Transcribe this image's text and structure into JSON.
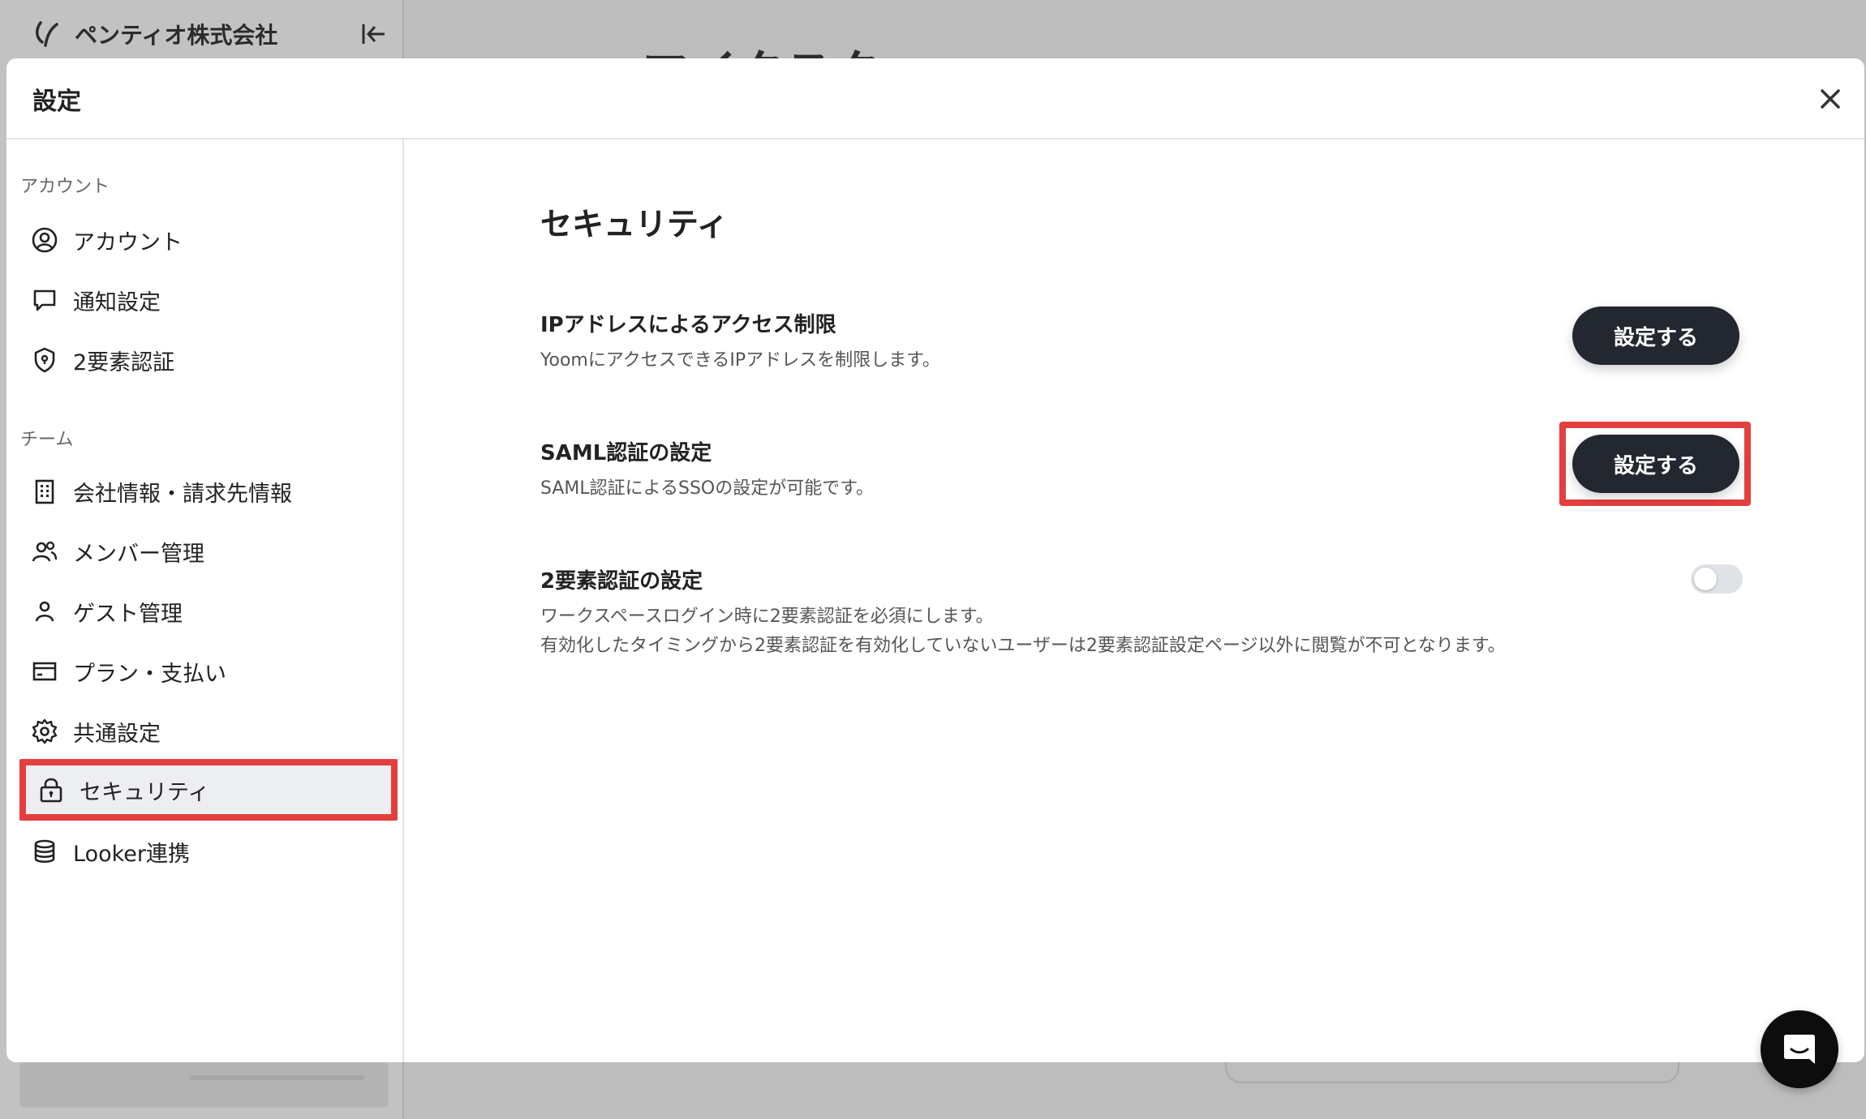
{
  "background": {
    "org_name": "ペンティオ株式会社",
    "title_peek": "マイクスク"
  },
  "modal": {
    "title": "設定"
  },
  "nav": {
    "account_section": "アカウント",
    "team_section": "チーム",
    "items": [
      {
        "label": "アカウント",
        "icon": "user-circle-icon"
      },
      {
        "label": "通知設定",
        "icon": "message-icon"
      },
      {
        "label": "2要素認証",
        "icon": "shield-icon"
      },
      {
        "label": "会社情報・請求先情報",
        "icon": "building-icon"
      },
      {
        "label": "メンバー管理",
        "icon": "users-icon"
      },
      {
        "label": "ゲスト管理",
        "icon": "user-icon"
      },
      {
        "label": "プラン・支払い",
        "icon": "credit-card-icon"
      },
      {
        "label": "共通設定",
        "icon": "gear-icon"
      },
      {
        "label": "セキュリティ",
        "icon": "lock-icon",
        "active": true
      },
      {
        "label": "Looker連携",
        "icon": "database-icon"
      }
    ]
  },
  "security": {
    "title": "セキュリティ",
    "ip_restriction": {
      "title": "IPアドレスによるアクセス制限",
      "description": "YoomにアクセスできるIPアドレスを制限します。",
      "button": "設定する"
    },
    "saml": {
      "title": "SAML認証の設定",
      "description": "SAML認証によるSSOの設定が可能です。",
      "button": "設定する"
    },
    "two_factor": {
      "title": "2要素認証の設定",
      "description_line1": "ワークスペースログイン時に2要素認証を必須にします。",
      "description_line2": "有効化したタイミングから2要素認証を有効化していないユーザーは2要素認証設定ページ以外に閲覧が不可となります。",
      "enabled": false
    }
  },
  "colors": {
    "highlight": "#e43f3f",
    "button_dark": "#232830"
  }
}
